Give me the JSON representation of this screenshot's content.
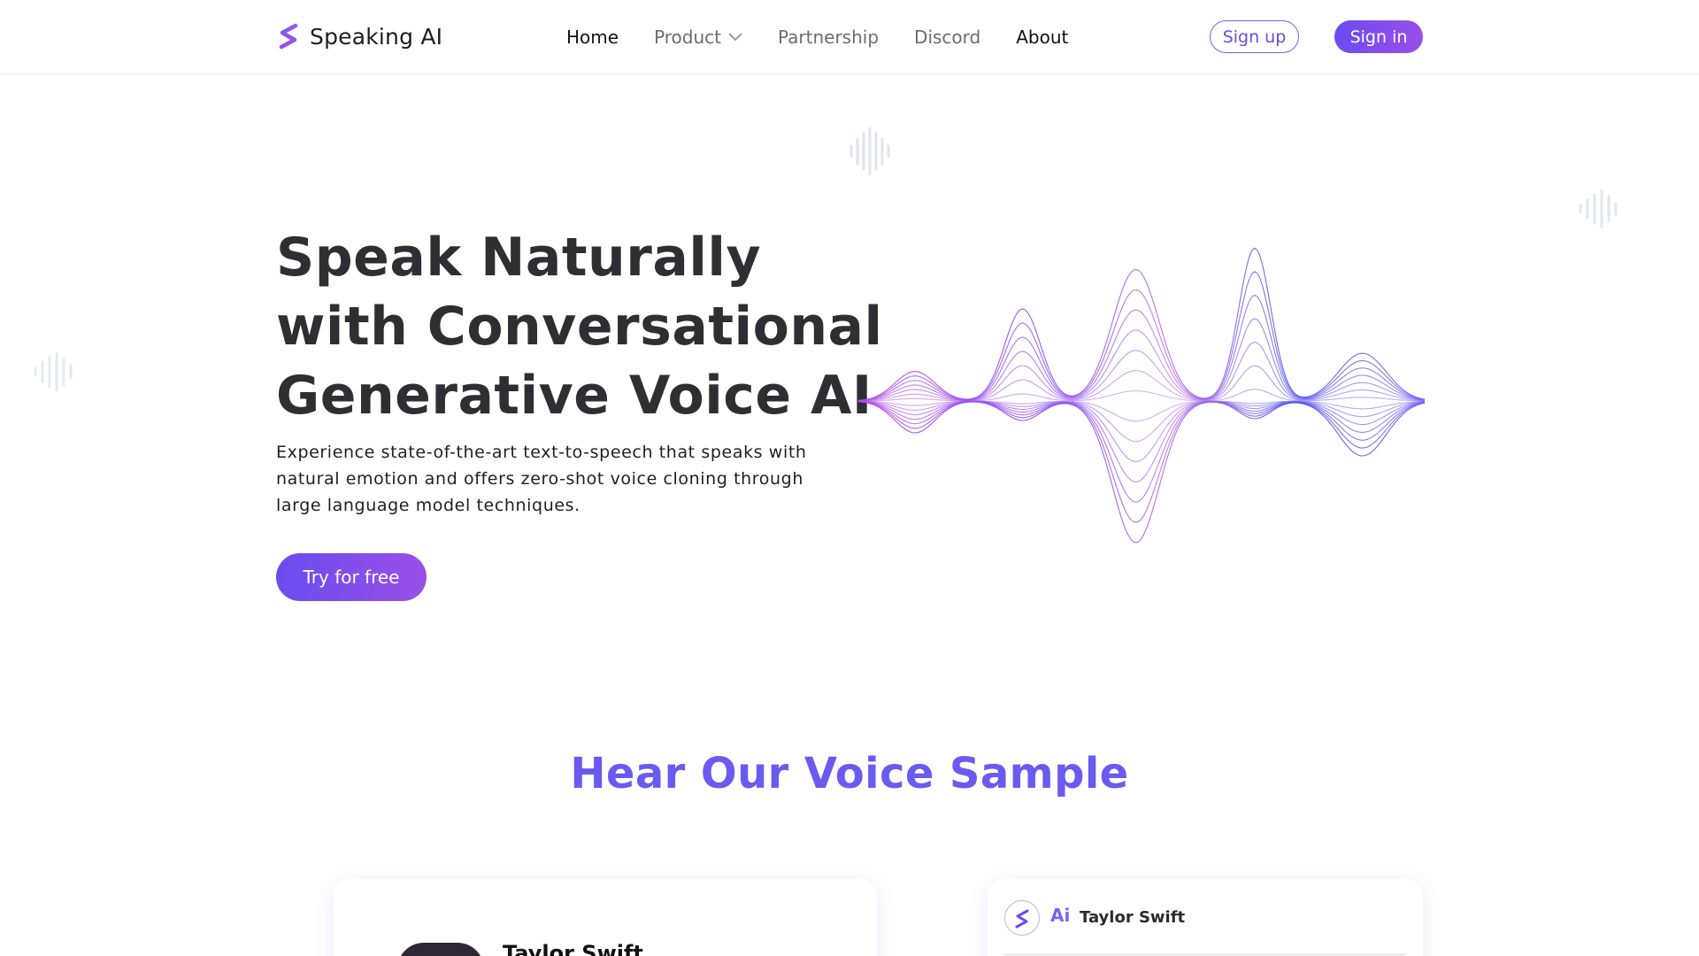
{
  "brand": {
    "name": "Speaking AI",
    "icon": "speaking-ai-logo-icon"
  },
  "nav": {
    "items": [
      {
        "label": "Home",
        "active": true
      },
      {
        "label": "Product",
        "has_dropdown": true
      },
      {
        "label": "Partnership"
      },
      {
        "label": "Discord"
      },
      {
        "label": "About"
      }
    ]
  },
  "auth": {
    "signup_label": "Sign up",
    "signin_label": "Sign in"
  },
  "hero": {
    "title_lines": [
      "Speak Naturally",
      "with Conversational",
      "Generative Voice AI"
    ],
    "subtitle": "Experience state-of-the-art text-to-speech that speaks with natural emotion and offers zero-shot voice cloning through large language model techniques.",
    "cta_label": "Try for free"
  },
  "voice_sample": {
    "heading": "Hear Our Voice Sample",
    "card_left": {
      "name": "Taylor Swift"
    },
    "card_right": {
      "ai_badge": "Ai",
      "name": "Taylor Swift"
    }
  },
  "colors": {
    "accent": "#6a4cf0",
    "accent_end": "#9a4ee8",
    "heading_accent": "#6a5af0",
    "title_text": "#2f2f33"
  }
}
